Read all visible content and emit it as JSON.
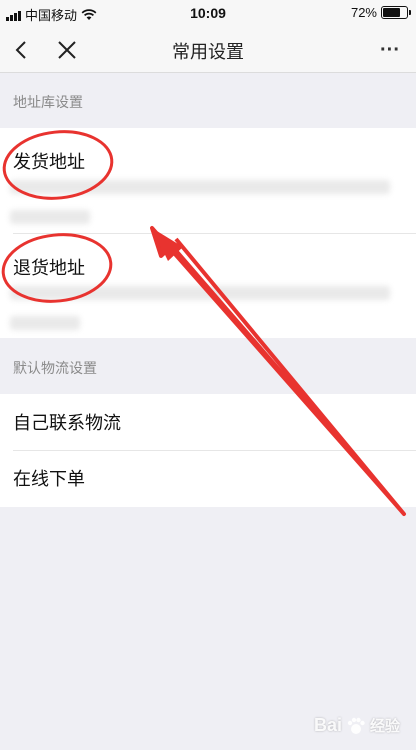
{
  "status_bar": {
    "carrier": "中国移动",
    "time": "10:09",
    "battery": "72%",
    "battery_level": 0.72
  },
  "nav": {
    "title": "常用设置",
    "more": "···"
  },
  "sections": {
    "address": {
      "header": "地址库设置"
    },
    "logistics": {
      "header": "默认物流设置"
    }
  },
  "rows": {
    "ship_address": "发货地址",
    "return_address": "退货地址",
    "self_logistics": "自己联系物流",
    "online_order": "在线下单"
  },
  "colors": {
    "annotation": "#e8332f",
    "background": "#efeff4"
  },
  "watermark": {
    "brand": "Bai",
    "brand_tail": "经验"
  }
}
